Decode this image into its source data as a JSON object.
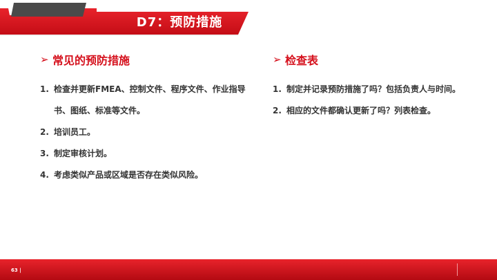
{
  "title": "D7：预防措施",
  "page_number": "63 |",
  "accent_color": "#d50f1b",
  "left": {
    "arrow_icon": "➢",
    "heading": "常见的预防措施",
    "items": [
      {
        "num": "1.",
        "text": "检查并更新FMEA、控制文件、程序文件、作业指导书、图纸、标准等文件。"
      },
      {
        "num": "2.",
        "text": "培训员工。"
      },
      {
        "num": "3.",
        "text": "制定审核计划。"
      },
      {
        "num": "4.",
        "text": "考虑类似产品或区域是否存在类似风险。"
      }
    ]
  },
  "right": {
    "arrow_icon": "➢",
    "heading": "检查表",
    "items": [
      {
        "num": "1.",
        "text": "制定并记录预防措施了吗？包括负责人与时间。"
      },
      {
        "num": "2.",
        "text": "相应的文件都确认更新了吗？列表检查。"
      }
    ]
  }
}
